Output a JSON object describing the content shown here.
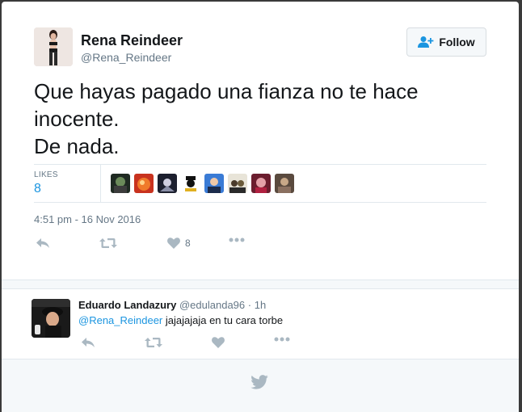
{
  "tweet": {
    "author_name": "Rena Reindeer",
    "author_handle": "@Rena_Reindeer",
    "follow_label": "Follow",
    "text_lines": [
      "Que hayas pagado una fianza no te hace",
      "inocente.",
      "De nada."
    ],
    "likes_label": "LIKES",
    "likes_count": "8",
    "timestamp": "4:51 pm - 16 Nov 2016",
    "like_action_count": "8",
    "icons": [
      "reply-icon",
      "retweet-icon",
      "heart-icon",
      "more-icon",
      "follow-person-icon"
    ]
  },
  "reply": {
    "author_name": "Eduardo Landazury",
    "author_handle": "@edulanda96",
    "dot": "·",
    "time": "1h",
    "mention": "@Rena_Reindeer",
    "text": " jajajajaja en tu cara torbe"
  },
  "footer": {
    "icon": "twitter-bird-icon"
  },
  "colors": {
    "accent": "#1b95e0",
    "text": "#14171a",
    "muted": "#657786",
    "icon": "#aab8c2",
    "border": "#e1e8ed",
    "footer_bg": "#f5f8fa"
  }
}
